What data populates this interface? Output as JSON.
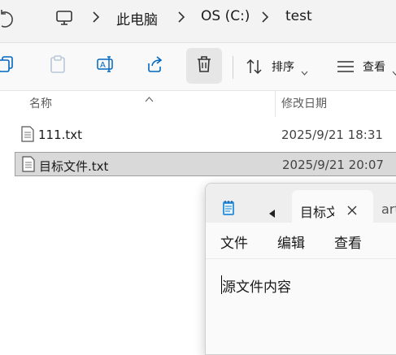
{
  "breadcrumb": {
    "items": [
      "此电脑",
      "OS (C:)",
      "test"
    ]
  },
  "toolbar": {
    "sort_label": "排序",
    "view_label": "查看"
  },
  "columns": {
    "name": "名称",
    "modified": "修改日期"
  },
  "files": [
    {
      "name": "111.txt",
      "modified": "2025/9/21 18:31",
      "selected": false
    },
    {
      "name": "目标文件.txt",
      "modified": "2025/9/21 20:07",
      "selected": true
    }
  ],
  "notepad": {
    "active_tab": "目标文",
    "next_tab": "art",
    "menus": [
      "文件",
      "编辑",
      "查看"
    ],
    "content": "源文件内容"
  },
  "icons": [
    "refresh-icon",
    "computer-icon",
    "copy-icon",
    "paste-icon",
    "rename-icon",
    "share-icon",
    "delete-icon",
    "sort-icon",
    "view-icon",
    "text-file-icon",
    "notepad-icon",
    "scroll-left-icon",
    "close-icon"
  ],
  "colors": {
    "selection": "#d9d9d9",
    "accent": "#0067c0"
  }
}
